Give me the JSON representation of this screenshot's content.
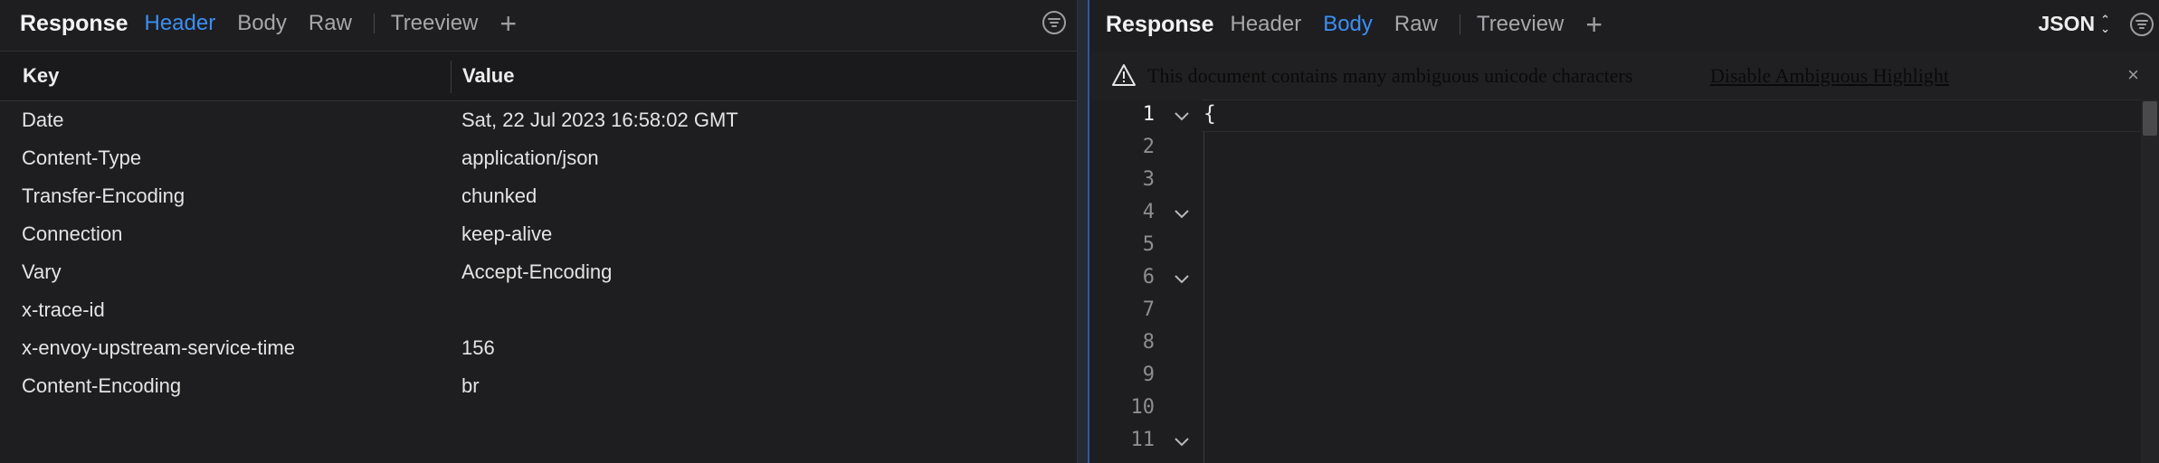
{
  "left": {
    "tabs": {
      "title": "Response",
      "header": "Header",
      "body": "Body",
      "raw": "Raw",
      "treeview": "Treeview",
      "add": "+"
    },
    "table": {
      "key_header": "Key",
      "value_header": "Value",
      "rows": [
        {
          "key": "Date",
          "value": "Sat, 22 Jul 2023 16:58:02 GMT"
        },
        {
          "key": "Content-Type",
          "value": "application/json"
        },
        {
          "key": "Transfer-Encoding",
          "value": "chunked"
        },
        {
          "key": "Connection",
          "value": "keep-alive"
        },
        {
          "key": "Vary",
          "value": "Accept-Encoding"
        },
        {
          "key": "x-trace-id",
          "value": ""
        },
        {
          "key": "x-envoy-upstream-service-time",
          "value": "156"
        },
        {
          "key": "Content-Encoding",
          "value": "br"
        }
      ]
    }
  },
  "right": {
    "tabs": {
      "title": "Response",
      "header": "Header",
      "body": "Body",
      "raw": "Raw",
      "treeview": "Treeview",
      "add": "+"
    },
    "format": "JSON",
    "warning": {
      "text": "This document contains many ambiguous unicode characters",
      "link": "Disable Ambiguous Highlight",
      "close": "×"
    },
    "editor": {
      "line_numbers": [
        "1",
        "2",
        "3",
        "4",
        "5",
        "6",
        "7",
        "8",
        "9",
        "10",
        "11"
      ],
      "first_line": "{"
    }
  },
  "colors": {
    "accent": "#3b8ff5",
    "background": "#1e1e20"
  }
}
